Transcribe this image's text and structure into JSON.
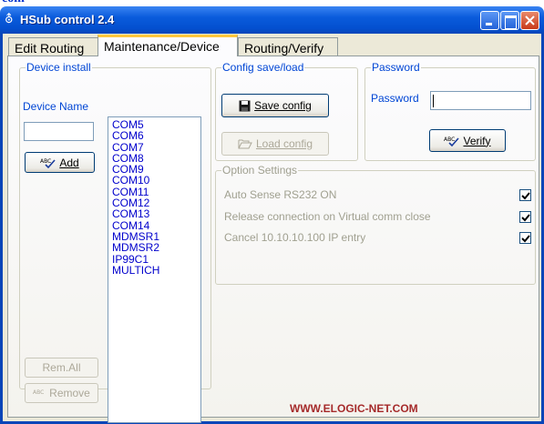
{
  "top_strip_text": "com",
  "window": {
    "title": "HSub control 2.4",
    "app_icon": "antenna-icon",
    "buttons": {
      "minimize_icon": "minimize-icon",
      "maximize_icon": "maximize-icon",
      "close_icon": "close-icon"
    }
  },
  "tabs": [
    {
      "label": "Edit Routing",
      "selected": false
    },
    {
      "label": "Maintenance/Device",
      "selected": true
    },
    {
      "label": "Routing/Verify",
      "selected": false
    }
  ],
  "device_install": {
    "legend": "Device install",
    "device_name_label": "Device Name",
    "device_name_value": "",
    "add_button": {
      "label": "Add",
      "icon": "spellcheck-icon"
    },
    "devices": [
      "COM5",
      "COM6",
      "COM7",
      "COM8",
      "COM9",
      "COM10",
      "COM11",
      "COM12",
      "COM13",
      "COM14",
      "MDMSR1",
      "MDMSR2",
      "IP99C1",
      "MULTICH"
    ],
    "rem_all_button": {
      "label": "Rem.All",
      "enabled": false
    },
    "remove_button": {
      "label": "Remove",
      "icon": "spellcheck-icon",
      "enabled": false
    }
  },
  "config": {
    "legend": "Config save/load",
    "save_button": {
      "label": "Save config",
      "icon": "floppy-disk-icon"
    },
    "load_button": {
      "label": "Load config",
      "icon": "open-folder-icon",
      "enabled": false
    }
  },
  "password": {
    "legend": "Password",
    "label": "Password",
    "value": "",
    "verify_button": {
      "label": "Verify",
      "icon": "spellcheck-icon"
    }
  },
  "option_settings": {
    "legend": "Option Settings",
    "enabled": false,
    "options": [
      {
        "label": "Auto Sense RS232 ON",
        "checked": true
      },
      {
        "label": "Release connection on Virtual comm close",
        "checked": true
      },
      {
        "label": "Cancel 10.10.10.100 IP entry",
        "checked": true
      }
    ]
  },
  "footer": "WWW.ELOGIC-NET.COM",
  "colors": {
    "title_bar": "#0a5bdc",
    "label_blue": "#0046d5",
    "list_text": "#0000cc",
    "footer": "#a52a2a"
  }
}
